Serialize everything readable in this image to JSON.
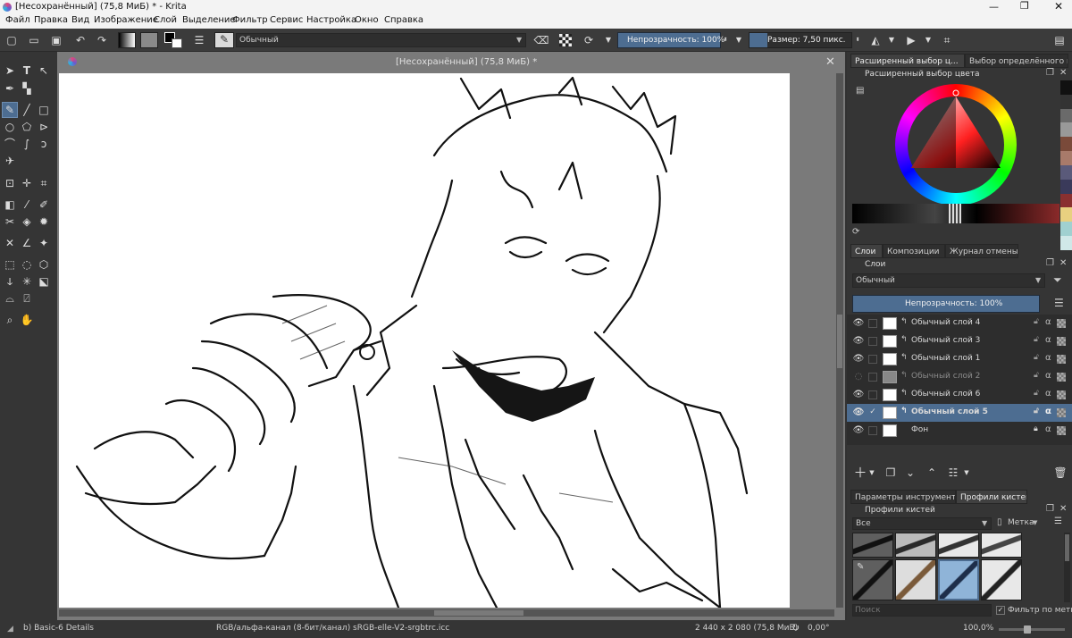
{
  "window": {
    "title": "[Несохранённый]  (75,8 МиБ) * - Krita"
  },
  "menu": [
    "Файл",
    "Правка",
    "Вид",
    "Изображение",
    "Слой",
    "Выделение",
    "Фильтр",
    "Сервис",
    "Настройка",
    "Окно",
    "Справка"
  ],
  "toolbar": {
    "blend_mode": "Обычный",
    "opacity_label": "Непрозрачность: 100%",
    "size_label": "Размер: 7,50 пикс."
  },
  "document": {
    "tab_title": "[Несохранённый]  (75,8 МиБ) *"
  },
  "docker_top": {
    "tabs": [
      "Расширенный выбор ц...",
      "Выбор определённого ц"
    ],
    "title": "Расширенный выбор цвета"
  },
  "layers_panel": {
    "tabs": [
      "Слои",
      "Композиции",
      "Журнал отмены"
    ],
    "title": "Слои",
    "blend_mode": "Обычный",
    "opacity_label": "Непрозрачность: 100%",
    "layers": [
      {
        "name": "Обычный слой 4",
        "visible": true,
        "active": false,
        "locked": false
      },
      {
        "name": "Обычный слой 3",
        "visible": true,
        "active": false,
        "locked": false
      },
      {
        "name": "Обычный слой 1",
        "visible": true,
        "active": false,
        "locked": false
      },
      {
        "name": "Обычный слой 2",
        "visible": false,
        "active": false,
        "locked": false
      },
      {
        "name": "Обычный слой 6",
        "visible": true,
        "active": false,
        "locked": false
      },
      {
        "name": "Обычный слой 5",
        "visible": true,
        "active": true,
        "locked": false
      },
      {
        "name": "Фон",
        "visible": true,
        "active": false,
        "locked": true
      }
    ]
  },
  "brush_panel": {
    "tabs": [
      "Параметры инструмента",
      "Профили кистей"
    ],
    "title": "Профили кистей",
    "filter_value": "Все",
    "tag_label": "Метка",
    "search_placeholder": "Поиск",
    "filter_checkbox": "Фильтр по метке"
  },
  "status": {
    "brush_preset": "b) Basic-6 Details",
    "color_profile": "RGB/альфа-канал (8-бит/канал)  sRGB-elle-V2-srgbtrc.icc",
    "image_size": "2 440 x 2 080 (75,8 МиБ)",
    "rotation": "0,00°",
    "zoom": "100,0%"
  },
  "colors": {
    "accent": "#4d6d91",
    "bg": "#353535"
  }
}
